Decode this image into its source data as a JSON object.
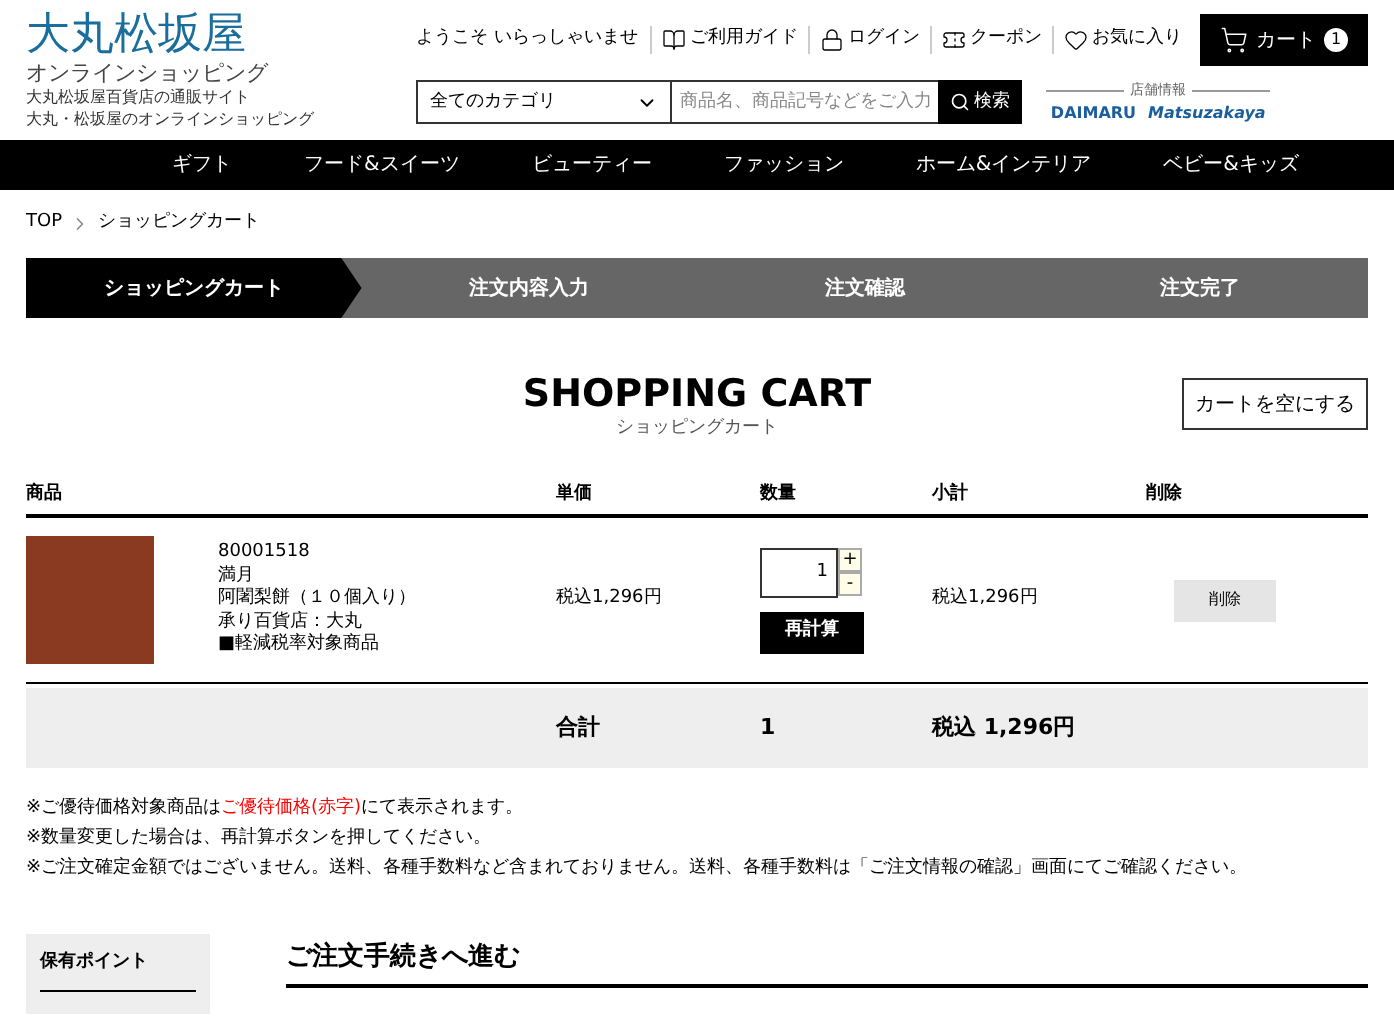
{
  "header": {
    "logo_main": "大丸松坂屋",
    "logo_sub": "オンラインショッピング",
    "tagline": [
      "大丸松坂屋百貨店の通販サイト",
      "大丸・松坂屋のオンラインショッピング"
    ],
    "welcome": "ようこそ いらっしゃいませ",
    "links": [
      {
        "kind": "guide",
        "label": "ご利用ガイド"
      },
      {
        "kind": "login",
        "label": "ログイン"
      },
      {
        "kind": "coupon",
        "label": "クーポン"
      },
      {
        "kind": "favorite",
        "label": "お気に入り"
      }
    ],
    "cart": {
      "label": "カート",
      "count": "1"
    },
    "category": "全てのカテゴリ",
    "search": {
      "placeholder": "商品名、商品記号などをご入力",
      "button": "検索"
    },
    "store_info": {
      "label": "店舗情報",
      "brands": [
        "DAIMARU",
        "Matsuzakaya"
      ]
    }
  },
  "nav": [
    "ギフト",
    "フード&スイーツ",
    "ビューティー",
    "ファッション",
    "ホーム&インテリア",
    "ベビー&キッズ"
  ],
  "breadcrumb": [
    "TOP",
    "ショッピングカート"
  ],
  "steps": [
    {
      "label": "ショッピングカート",
      "selected": true
    },
    {
      "label": "注文内容入力",
      "selected": false
    },
    {
      "label": "注文確認",
      "selected": false
    },
    {
      "label": "注文完了",
      "selected": false
    }
  ],
  "title": "SHOPPING CART",
  "subtitle": "ショッピングカート",
  "empty_button": "カートを空にする",
  "table": {
    "columns": [
      "商品",
      "単価",
      "数量",
      "小計",
      "削除"
    ],
    "rows": [
      {
        "code": "80001518",
        "details": [
          "満月",
          "阿闍梨餅（１０個入り）",
          "承り百貨店：大丸",
          "■軽減税率対象商品"
        ],
        "price": "税込1,296円",
        "quantity": "1",
        "plus": "+",
        "minus": "-",
        "recalc": "再計算",
        "subtotal": "税込1,296円",
        "delete": "削除"
      }
    ],
    "total": {
      "label": "合計",
      "quantity": "1",
      "amount": "税込 1,296円"
    }
  },
  "notes": [
    {
      "before": "※ご優待価格対象商品は",
      "highlight": "ご優待価格(赤字)",
      "after": "にて表示されます。"
    },
    {
      "before": "※数量変更した場合は、再計算ボタンを押してください。"
    },
    {
      "before": "※ご注文確定金額ではございません。送料、各種手数料など含まれておりません。送料、各種手数料は「ご注文情報の確認」画面にてご確認ください。"
    }
  ],
  "points_label": "保有ポイント",
  "proceed_title": "ご注文手続きへ進む"
}
